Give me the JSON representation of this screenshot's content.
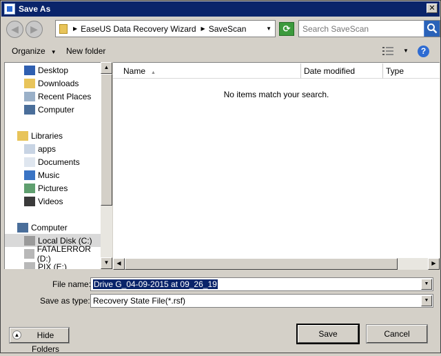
{
  "window": {
    "title": "Save As",
    "close_label": "✕"
  },
  "address": {
    "crumbs": [
      "EaseUS Data Recovery Wizard",
      "SaveScan"
    ]
  },
  "search": {
    "placeholder": "Search SaveScan"
  },
  "toolbar": {
    "organize": "Organize",
    "new_folder": "New folder",
    "help": "?"
  },
  "nav": {
    "favorites": [
      "Desktop",
      "Downloads",
      "Recent Places",
      "Computer"
    ],
    "libraries_label": "Libraries",
    "libraries": [
      "apps",
      "Documents",
      "Music",
      "Pictures",
      "Videos"
    ],
    "computer_label": "Computer",
    "drives": [
      "Local Disk (C:)",
      "FATALERROR (D:)",
      "PIX (E:)"
    ]
  },
  "list": {
    "columns": [
      "Name",
      "Date modified",
      "Type"
    ],
    "empty_message": "No items match your search."
  },
  "form": {
    "filename_label": "File name:",
    "filename_value": "Drive G_04-09-2015 at 09_26_19",
    "filetype_label": "Save as type:",
    "filetype_value": "Recovery State File(*.rsf)"
  },
  "buttons": {
    "hide_folders": "Hide Folders",
    "save": "Save",
    "cancel": "Cancel"
  }
}
